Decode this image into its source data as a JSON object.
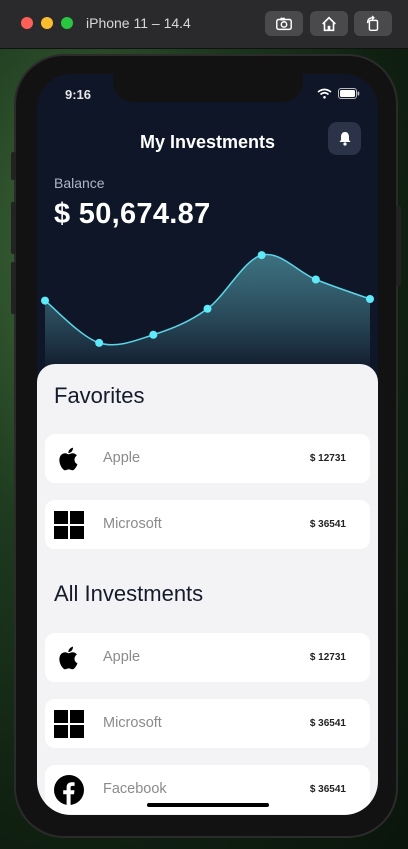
{
  "window": {
    "title": "iPhone 11 – 14.4",
    "buttons": [
      "screenshot-icon",
      "home-icon",
      "rotate-icon"
    ]
  },
  "status_bar": {
    "time": "9:16"
  },
  "header": {
    "title": "My Investments",
    "notification_icon": "bell-icon"
  },
  "balance": {
    "label": "Balance",
    "value": "$ 50,674.87"
  },
  "chart_data": {
    "type": "area",
    "x": [
      0,
      1,
      2,
      3,
      4,
      5,
      6
    ],
    "values": [
      6.9,
      4.3,
      4.8,
      6.4,
      9.7,
      8.2,
      7.0
    ],
    "ylim": [
      3,
      11
    ],
    "title": "",
    "xlabel": "",
    "ylabel": "",
    "colors": {
      "line": "#5ad6e8",
      "point": "#5eeaf8",
      "fill_top": "#4c8f9c",
      "fill_bottom": "#0f1628"
    }
  },
  "favorites": {
    "title": "Favorites",
    "items": [
      {
        "icon": "apple-icon",
        "name": "Apple",
        "amount": "$ 12731"
      },
      {
        "icon": "microsoft-icon",
        "name": "Microsoft",
        "amount": "$ 36541"
      }
    ]
  },
  "all_investments": {
    "title": "All Investments",
    "items": [
      {
        "icon": "apple-icon",
        "name": "Apple",
        "amount": "$ 12731"
      },
      {
        "icon": "microsoft-icon",
        "name": "Microsoft",
        "amount": "$ 36541"
      },
      {
        "icon": "facebook-icon",
        "name": "Facebook",
        "amount": "$ 36541"
      }
    ]
  }
}
